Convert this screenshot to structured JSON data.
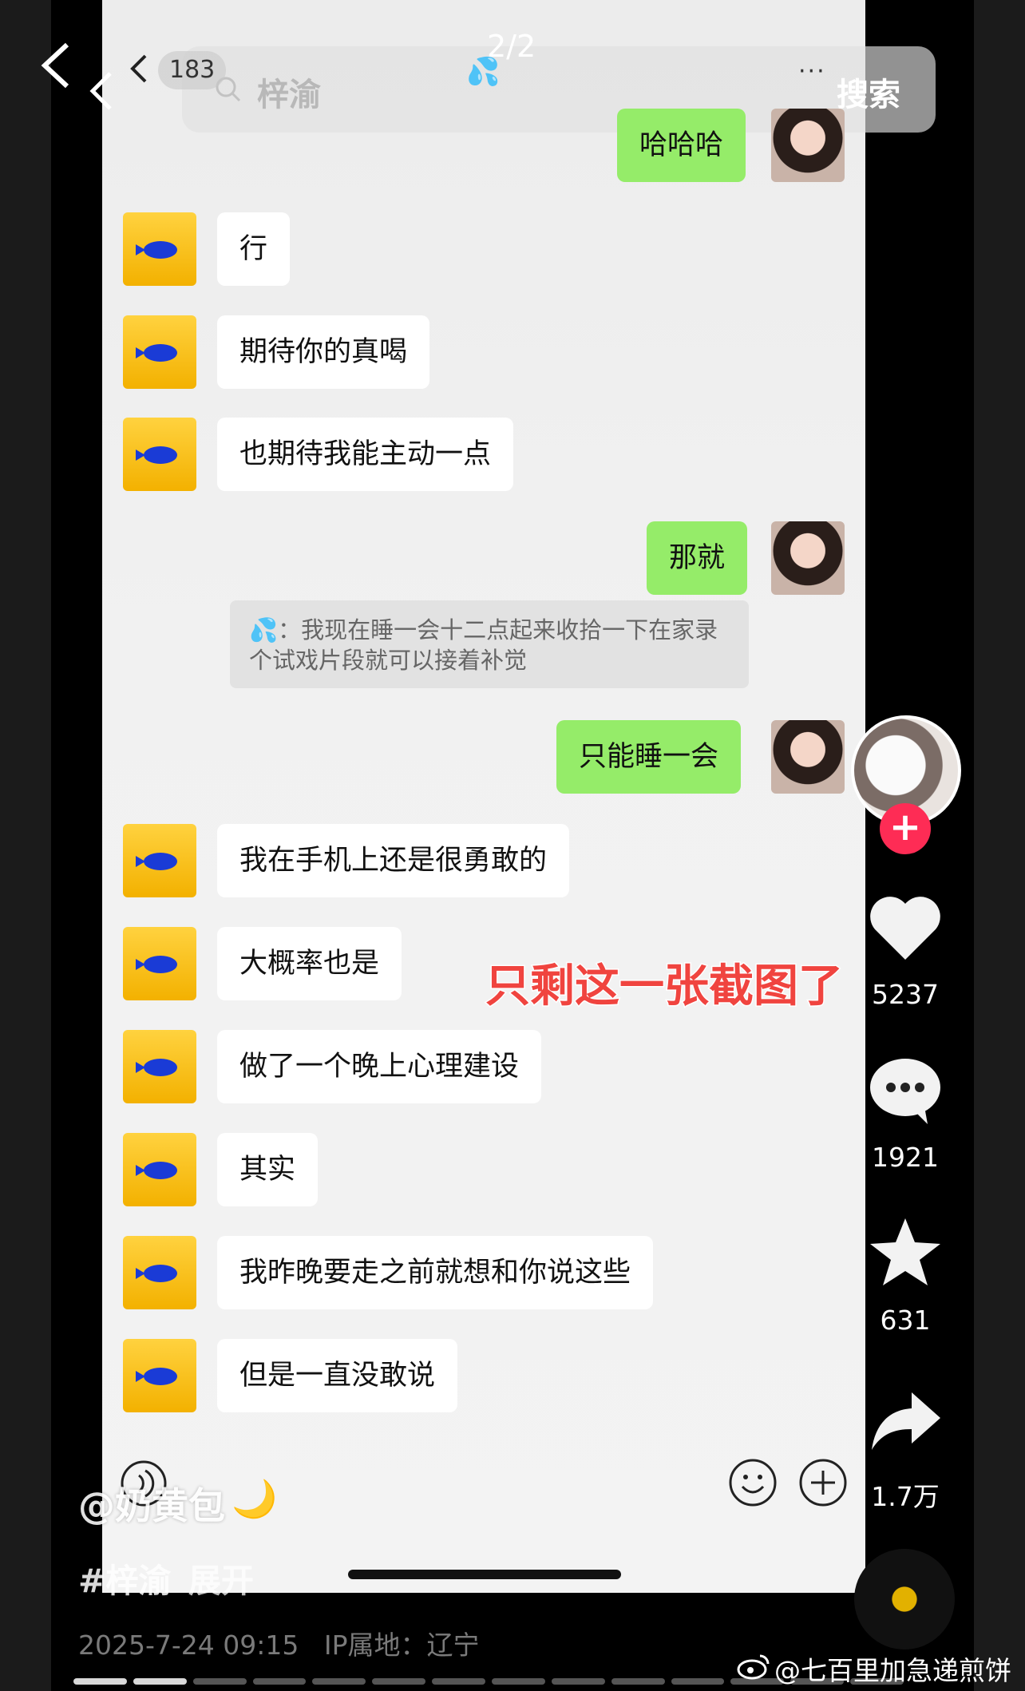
{
  "viewer": {
    "page_indicator": "2/2"
  },
  "chat_header": {
    "unread_count": "183",
    "search_name": "梓渝",
    "more": "···",
    "search_button": "搜索",
    "sweat_emoji": "💦"
  },
  "messages": [
    {
      "side": "right",
      "text": "哈哈哈"
    },
    {
      "side": "left",
      "text": "行"
    },
    {
      "side": "left",
      "text": "期待你的真喝"
    },
    {
      "side": "left",
      "text": "也期待我能主动一点"
    },
    {
      "side": "right",
      "text": "那就"
    },
    {
      "side": "right",
      "text": "只能睡一会"
    },
    {
      "side": "left",
      "text": "我在手机上还是很勇敢的"
    },
    {
      "side": "left",
      "text": "大概率也是"
    },
    {
      "side": "left",
      "text": "做了一个晚上心理建设"
    },
    {
      "side": "left",
      "text": "其实"
    },
    {
      "side": "left",
      "text": "我昨晚要走之前就想和你说这些"
    },
    {
      "side": "left",
      "text": "但是一直没敢说"
    }
  ],
  "quote": {
    "prefix": "💦：",
    "text": "我现在睡一会十二点起来收拾一下在家录个试戏片段就可以接着补觉"
  },
  "overlay_caption": "只剩这一张截图了",
  "actions": {
    "likes": "5237",
    "comments": "1921",
    "favorites": "631",
    "shares": "1.7万"
  },
  "post": {
    "author": "@奶黄包",
    "moon": "🌙",
    "hashtag": "#梓渝",
    "expand": "展开",
    "datetime": "2025-7-24 09:15",
    "ip_location": "IP属地：辽宁"
  },
  "video_progress": {
    "segments": 14,
    "current": 2
  },
  "watermark": "@七百里加急递煎饼",
  "colors": {
    "own_bubble": "#95ec69",
    "follow_button": "#fe2c55",
    "overlay_text": "#f0443f"
  },
  "icons": [
    "back-icon",
    "search-icon",
    "voice-icon",
    "emoji-icon",
    "plus-icon",
    "heart-icon",
    "comment-icon",
    "star-icon",
    "share-icon",
    "weibo-icon"
  ]
}
